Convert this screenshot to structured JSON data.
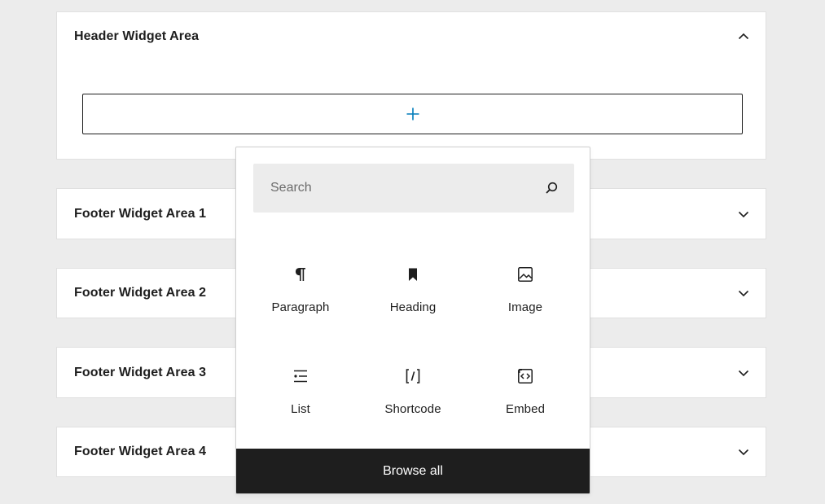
{
  "panels": {
    "header_area": {
      "title": "Header Widget Area",
      "icon": "chevron-up-icon"
    },
    "footer_1": {
      "title": "Footer Widget Area 1",
      "icon": "chevron-down-icon"
    },
    "footer_2": {
      "title": "Footer Widget Area 2",
      "icon": "chevron-down-icon"
    },
    "footer_3": {
      "title": "Footer Widget Area 3",
      "icon": "chevron-down-icon"
    },
    "footer_4": {
      "title": "Footer Widget Area 4",
      "icon": "chevron-down-icon"
    }
  },
  "appender": {
    "icon": "plus-icon",
    "color": "#007cba"
  },
  "inserter": {
    "search": {
      "placeholder": "Search",
      "value": "",
      "icon": "search-icon"
    },
    "blocks": [
      {
        "label": "Paragraph",
        "icon": "paragraph-icon"
      },
      {
        "label": "Heading",
        "icon": "heading-bookmark-icon"
      },
      {
        "label": "Image",
        "icon": "image-icon"
      },
      {
        "label": "List",
        "icon": "list-icon"
      },
      {
        "label": "Shortcode",
        "icon": "shortcode-icon"
      },
      {
        "label": "Embed",
        "icon": "embed-icon"
      }
    ],
    "browse_all_label": "Browse all"
  },
  "colors": {
    "background": "#ececec",
    "text": "#1e1e1e",
    "accent": "#007cba",
    "browse_bg": "#1e1e1e"
  }
}
